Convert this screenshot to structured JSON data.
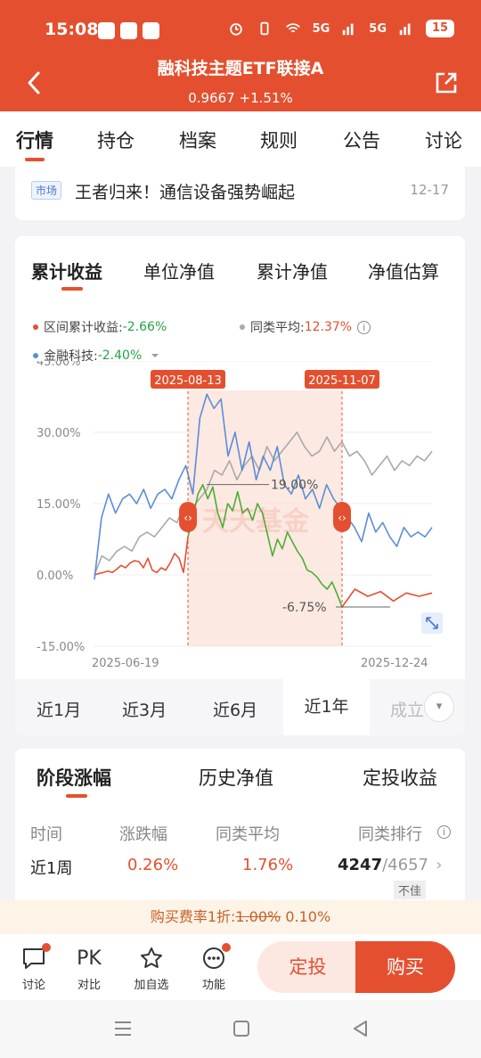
{
  "status": {
    "time": "15:08",
    "signal1": "5G",
    "signal2": "5G",
    "battery": "15"
  },
  "header": {
    "title": "融科技主题ETF联接A",
    "nav_value": "0.9667",
    "nav_change": "+1.51%"
  },
  "tabs": [
    "行情",
    "持仓",
    "档案",
    "规则",
    "公告",
    "讨论"
  ],
  "news": {
    "tag": "市场",
    "text": "王者归来！通信设备强势崛起",
    "date": "12-17"
  },
  "chart_tabs": [
    "累计收益",
    "单位净值",
    "累计净值",
    "净值估算"
  ],
  "legend": {
    "interval_label": "区间累计收益:",
    "interval_value": "-2.66%",
    "peer_label": "同类平均:",
    "peer_value": "12.37%",
    "index_label": "金融科技:",
    "index_value": "-2.40%"
  },
  "range": {
    "start_label": "2025-08-13",
    "end_label": "2025-11-07",
    "max_label": "19.00%",
    "min_label": "-6.75%",
    "watermark": "天天基金"
  },
  "chart_data": {
    "type": "line",
    "x_start": "2025-06-19",
    "x_end": "2025-12-24",
    "yticks": [
      "45.00%",
      "30.00%",
      "15.00%",
      "0.00%",
      "-15.00%"
    ],
    "ylim": [
      -15,
      45
    ],
    "grid": true,
    "series": [
      {
        "name": "区间累计收益",
        "color": "#e4502f",
        "values": [
          0,
          0.3,
          0.5,
          0.8,
          0.5,
          1.2,
          2.0,
          1.5,
          2.5,
          3.0,
          2.8,
          1.5,
          3.5,
          1.0,
          0.5,
          1.5,
          1.0,
          2.5,
          4.5,
          3.5,
          0.5,
          8.0
        ]
      },
      {
        "name": "区间累计收益",
        "color": "#4caf34",
        "values": [
          8.0,
          12.0,
          17.0,
          19.0,
          16.0,
          18.5,
          13.0,
          10.0,
          15.0,
          13.5,
          17.5,
          13.0,
          14.0,
          11.5,
          15.0,
          13.0,
          8.5,
          4.0,
          7.5,
          5.5,
          9.0,
          7.0,
          5.0,
          3.5,
          1.0,
          0.5,
          -0.5,
          -2.0,
          -3.0,
          -1.5,
          -4.0,
          -6.75
        ]
      },
      {
        "name": "区间累计收益",
        "color": "#e4502f",
        "values": [
          -6.75,
          -3.0,
          -4.5,
          -3.5,
          -5.5,
          -3.8,
          -4.5,
          -3.8
        ]
      },
      {
        "name": "金融科技",
        "color": "#5b8dd6",
        "values": [
          -1,
          12,
          17,
          13,
          16,
          17,
          15,
          18,
          14,
          17,
          18,
          16,
          20,
          23,
          17,
          33,
          38,
          35,
          37,
          25,
          30,
          22,
          28,
          20,
          25,
          22,
          27,
          19,
          17,
          21,
          16,
          18,
          14,
          19,
          16,
          14,
          12,
          10,
          7,
          13,
          9,
          11,
          8,
          6,
          10,
          8,
          9,
          8,
          10
        ]
      },
      {
        "name": "同类平均",
        "color": "#a9a9a9",
        "values": [
          0,
          4,
          3,
          5,
          6,
          5,
          8,
          9,
          8,
          10,
          12,
          11,
          15,
          14,
          16,
          18,
          22,
          21,
          24,
          20,
          23,
          25,
          22,
          27,
          24,
          26,
          28,
          30,
          27,
          25,
          26,
          29,
          26,
          28,
          25,
          26,
          24,
          21,
          23,
          25,
          22,
          24,
          23,
          25,
          24,
          26
        ]
      }
    ]
  },
  "periods": [
    "近1月",
    "近3月",
    "近6月",
    "近1年",
    "成立"
  ],
  "stage_tabs": [
    "阶段涨幅",
    "历史净值",
    "定投收益"
  ],
  "stage_table": {
    "headers": [
      "时间",
      "涨跌幅",
      "同类平均",
      "同类排行"
    ],
    "row": {
      "period": "近1周",
      "change": "0.26%",
      "peer_avg": "1.76%",
      "rank": "4247",
      "total": "/4657",
      "rating": "不佳"
    }
  },
  "promo": {
    "prefix": "购买费率1折:",
    "old_rate": "1.00%",
    "new_rate": "0.10%"
  },
  "bottom": {
    "discuss": "讨论",
    "pk": "PK",
    "compare": "对比",
    "watch": "加自选",
    "func": "功能",
    "dingtou": "定投",
    "buy": "购买"
  }
}
